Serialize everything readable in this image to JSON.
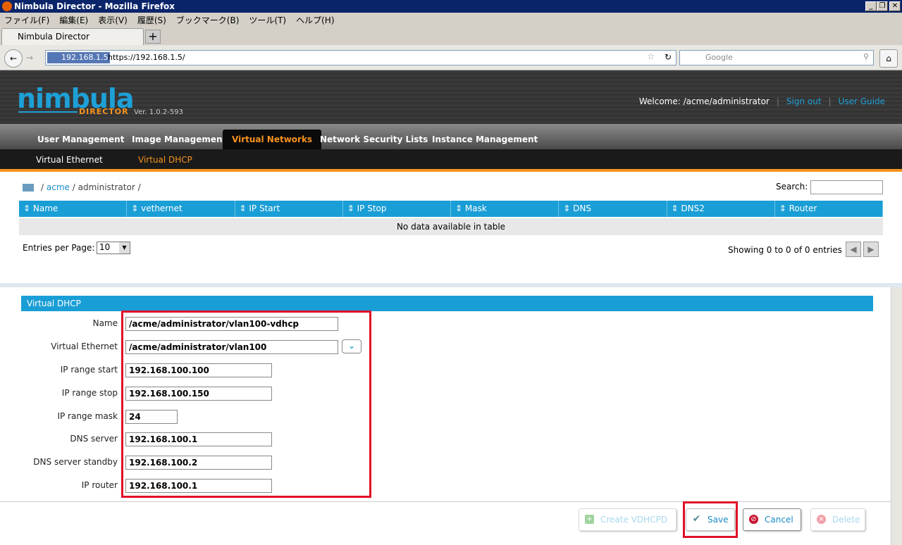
{
  "window": {
    "title": "Nimbula Director - Mozilla Firefox"
  },
  "menu": [
    "ファイル(F)",
    "編集(E)",
    "表示(V)",
    "履歴(S)",
    "ブックマーク(B)",
    "ツール(T)",
    "ヘルプ(H)"
  ],
  "tab": {
    "title": "Nimbula Director",
    "new": "+"
  },
  "nav": {
    "identity": "192.168.1.5",
    "url": "https://192.168.1.5/",
    "search_placeholder": "Google"
  },
  "header": {
    "logo": "nimbula",
    "logo_sub": "DIRECTOR",
    "version": "Ver. 1.0.2-593",
    "welcome": "Welcome: /acme/administrator",
    "sign_out": "Sign out",
    "user_guide": "User Guide"
  },
  "main_tabs": [
    {
      "label": "User Management"
    },
    {
      "label": "Image Management"
    },
    {
      "label": "Virtual Networks",
      "active": true
    },
    {
      "label": "Network Security Lists"
    },
    {
      "label": "Instance Management"
    }
  ],
  "sub_tabs": [
    {
      "label": "Virtual Ethernet"
    },
    {
      "label": "Virtual DHCP",
      "active": true
    }
  ],
  "breadcrumb": {
    "sep": "/",
    "acme": "acme",
    "admin": "administrator"
  },
  "search": {
    "label": "Search:"
  },
  "table": {
    "columns": [
      "Name",
      "vethernet",
      "IP Start",
      "IP Stop",
      "Mask",
      "DNS",
      "DNS2",
      "Router"
    ],
    "empty": "No data available in table",
    "entries_label": "Entries per Page:",
    "entries_value": "10",
    "showing": "Showing 0 to 0 of 0 entries"
  },
  "form": {
    "title": "Virtual DHCP",
    "fields": [
      {
        "label": "Name",
        "value": "/acme/administrator/vlan100-vdhcp"
      },
      {
        "label": "Virtual Ethernet",
        "value": "/acme/administrator/vlan100"
      },
      {
        "label": "IP range start",
        "value": "192.168.100.100"
      },
      {
        "label": "IP range stop",
        "value": "192.168.100.150"
      },
      {
        "label": "IP range mask",
        "value": "24"
      },
      {
        "label": "DNS server",
        "value": "192.168.100.1"
      },
      {
        "label": "DNS server standby",
        "value": "192.168.100.2"
      },
      {
        "label": "IP router",
        "value": "192.168.100.1"
      }
    ]
  },
  "buttons": {
    "create": "Create VDHCPD",
    "save": "Save",
    "cancel": "Cancel",
    "delete": "Delete"
  },
  "colors": {
    "accent": "#1a9ed6",
    "orange": "#f7931e",
    "highlight": "#e0102a"
  }
}
